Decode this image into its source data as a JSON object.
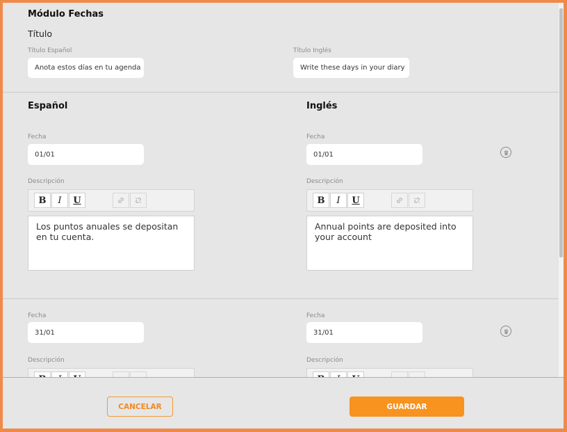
{
  "module": {
    "title": "Módulo Fechas",
    "subtitle": "Título",
    "title_es": {
      "label": "Título Español",
      "value": "Anota estos días en tu agenda"
    },
    "title_en": {
      "label": "Título Inglés",
      "value": "Write these days in your diary"
    }
  },
  "columns": {
    "es_heading": "Español",
    "en_heading": "Inglés"
  },
  "entries": [
    {
      "es": {
        "date_label": "Fecha",
        "date": "01/01",
        "desc_label": "Descripción",
        "desc": "Los puntos anuales se depositan en tu cuenta."
      },
      "en": {
        "date_label": "Fecha",
        "date": "01/01",
        "desc_label": "Descripción",
        "desc": "Annual points are deposited into your account"
      }
    },
    {
      "es": {
        "date_label": "Fecha",
        "date": "31/01",
        "desc_label": "Descripción",
        "desc": ""
      },
      "en": {
        "date_label": "Fecha",
        "date": "31/01",
        "desc_label": "Descripción",
        "desc": ""
      }
    }
  ],
  "toolbar": {
    "bold": "B",
    "italic": "I",
    "underline": "U"
  },
  "icons": {
    "link": "link-icon",
    "unlink": "unlink-icon",
    "delete": "trash-icon"
  },
  "footer": {
    "cancel": "CANCELAR",
    "save": "GUARDAR"
  },
  "colors": {
    "accent": "#f7931e",
    "frame": "#f08a4b",
    "background": "#e6e6e6"
  }
}
